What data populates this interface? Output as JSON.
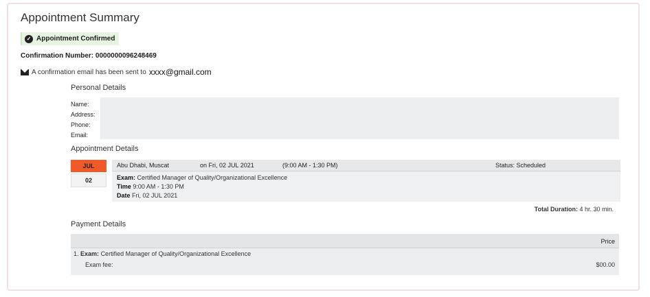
{
  "page": {
    "title": "Appointment Summary",
    "confirmed_badge": "Appointment Confirmed",
    "confirmation_label": "Confirmation Number: 0000000096248469",
    "email_sent_text": "A confirmation email has been sent to",
    "email_address": "xxxx@gmail.com"
  },
  "personal": {
    "heading": "Personal Details",
    "labels": [
      "Name:",
      "Address:",
      "Phone:",
      "Email:"
    ]
  },
  "appointment": {
    "heading": "Appointment Details",
    "month": "JUL",
    "day": "02",
    "location": "Abu Dhabi, Muscat",
    "date_text": "on Fri, 02 JUL 2021",
    "time_range": "(9:00 AM - 1:30 PM)",
    "status": "Status: Scheduled",
    "exam_label": "Exam:",
    "exam_value": "Certified Manager of Quality/Organizational Excellence",
    "time_label": "Time",
    "time_value": "9:00 AM - 1:30 PM",
    "date_label": "Date",
    "date_value": "Fri, 02 JUL 2021",
    "total_label": "Total Duration:",
    "total_value": "4 hr. 30 min."
  },
  "payment": {
    "heading": "Payment Details",
    "price_header": "Price",
    "item_prefix": "1.",
    "exam_label": "Exam:",
    "exam_value": "Certified Manager of Quality/Organizational Excellence",
    "fee_label": "Exam fee:",
    "fee_amount": "$00.00"
  },
  "colors": {
    "accent_orange": "#f05a28",
    "confirm_bg": "#e6f4e1",
    "panel_bg": "#eceef0"
  },
  "icons": {
    "confirm": "check-circle-icon",
    "email": "envelope-icon"
  }
}
